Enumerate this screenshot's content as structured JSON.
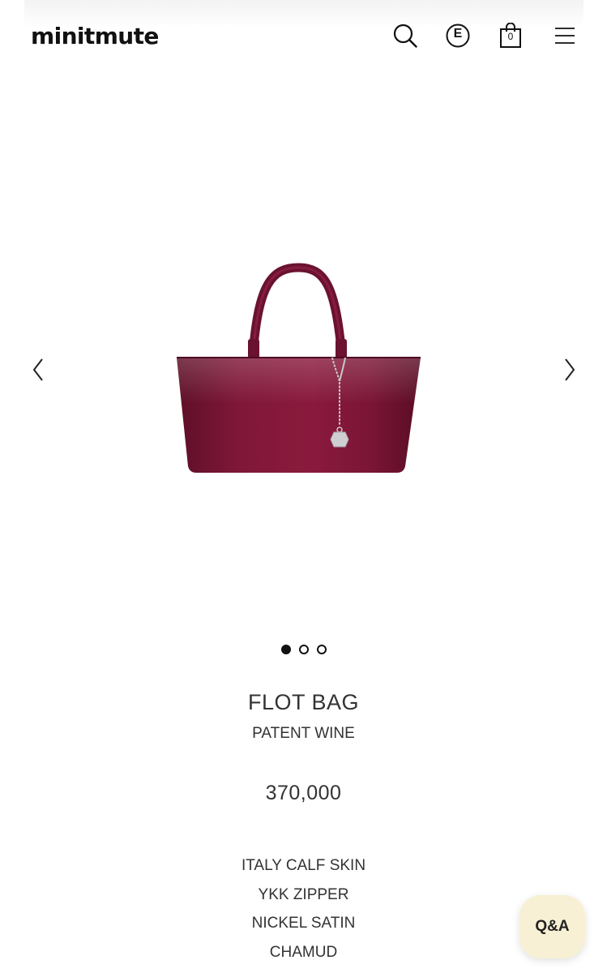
{
  "header": {
    "logo": "minitmute",
    "cart_count": "0",
    "currency_label": "E",
    "icons": [
      "search-icon",
      "currency-icon",
      "shopping-bag-icon",
      "hamburger-menu-icon"
    ]
  },
  "gallery": {
    "image_alt": "FLOT BAG PATENT WINE",
    "slide_count": 3,
    "active_slide": 1,
    "icons": [
      "chevron-left-icon",
      "chevron-right-icon"
    ]
  },
  "product": {
    "name": "FLOT BAG",
    "color": "PATENT WINE",
    "price": "370,000",
    "specs": [
      "ITALY CALF SKIN",
      "YKK ZIPPER",
      "NICKEL SATIN",
      "CHAMUD"
    ]
  },
  "qa": {
    "label": "Q&A"
  },
  "colors": {
    "bag": "#7a1535",
    "qa_bg": "#f7f0d4",
    "text": "#333333"
  }
}
